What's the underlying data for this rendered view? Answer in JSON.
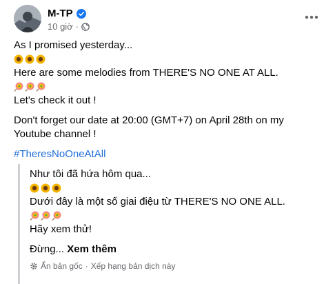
{
  "post": {
    "author": "M-TP",
    "time": "10 giờ",
    "lines": {
      "l1": "As I promised yesterday...",
      "l2": "Here are some melodies from THERE'S NO ONE AT ALL.",
      "l3": "Let's check it out !",
      "l4": "Don't forget our date at 20:00 (GMT+7) on April 28th on my Youtube channel !",
      "hashtag": "#TheresNoOneAtAll"
    }
  },
  "translation": {
    "l1": "Như tôi đã hứa hôm qua...",
    "l2": "Dưới đây là một số giai điệu từ THERE'S NO ONE ALL.",
    "l3": "Hãy xem thử!",
    "l4_prefix": "Đừng... ",
    "see_more": "Xem thêm",
    "footer": {
      "original": "Ẩn bản gốc",
      "separator": "·",
      "rate": "Xếp hạng bản dịch này"
    }
  },
  "icons": {
    "sunflower": "sunflower-icon",
    "lollipop": "lollipop-icon",
    "verified": "verified-badge-icon",
    "globe": "globe-icon",
    "more": "more-options-icon",
    "gear": "gear-icon"
  },
  "colors": {
    "link": "#216fdb",
    "verified": "#1877f2",
    "muted": "#65676b",
    "quote_bar": "#ced0d4"
  }
}
